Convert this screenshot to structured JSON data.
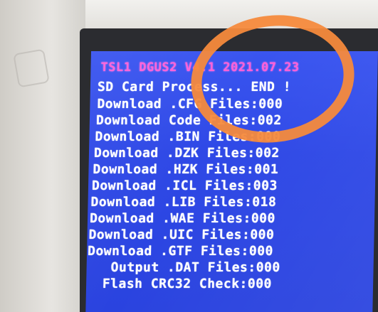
{
  "screen": {
    "title": "TSL1 DGUS2 V4.1 2021.07.23",
    "header": "SD Card Process... END !",
    "lines": [
      "Download .CFG Files:000",
      "Download Code Files:002",
      "Download .BIN Files:000",
      "Download .DZK Files:002",
      "Download .HZK Files:001",
      "Download .ICL Files:003",
      "Download .LIB Files:018",
      "Download .WAE Files:000",
      "Download .UIC Files:000",
      "Download .GTF Files:000",
      "   Output .DAT Files:000",
      "  Flash CRC32 Check:000"
    ]
  },
  "colors": {
    "screen_bg": "#3050ea",
    "title_text": "#ff5fd8",
    "body_text": "#ffffff",
    "annotation": "#f58a3c"
  }
}
